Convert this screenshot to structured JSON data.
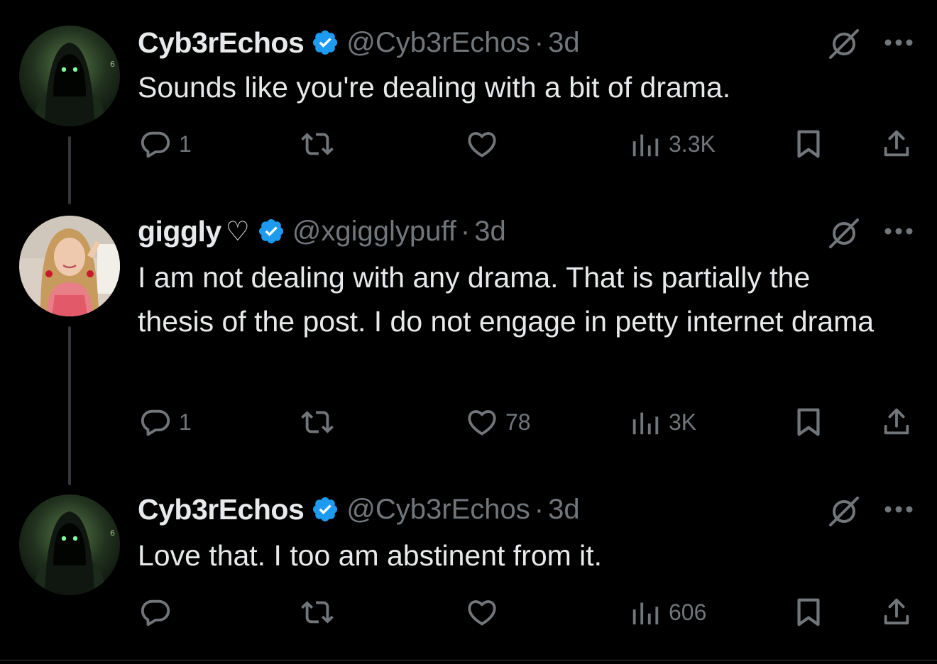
{
  "colors": {
    "background": "#000000",
    "text": "#e7e9ea",
    "muted": "#71767b",
    "verified": "#1d9bf0",
    "thread_line": "#333639"
  },
  "tweets": [
    {
      "display_name": "Cyb3rEchos",
      "handle": "@Cyb3rEchos",
      "separator": "·",
      "time": "3d",
      "text": "Sounds like you're dealing with a bit of drama.",
      "replies": "1",
      "reposts": "",
      "likes": "",
      "views": "3.3K",
      "avatar_icon": "hooded-figure-avatar"
    },
    {
      "display_name": "giggly",
      "name_emoji": "♡",
      "handle": "@xgigglypuff",
      "separator": "·",
      "time": "3d",
      "text": "I am not dealing with any drama. That is partially the thesis of the post. I do not engage in petty internet drama",
      "replies": "1",
      "reposts": "",
      "likes": "78",
      "views": "3K",
      "avatar_icon": "person-photo-avatar"
    },
    {
      "display_name": "Cyb3rEchos",
      "handle": "@Cyb3rEchos",
      "separator": "·",
      "time": "3d",
      "text": "Love that. I too am abstinent from it.",
      "replies": "",
      "reposts": "",
      "likes": "",
      "views": "606",
      "avatar_icon": "hooded-figure-avatar"
    }
  ]
}
